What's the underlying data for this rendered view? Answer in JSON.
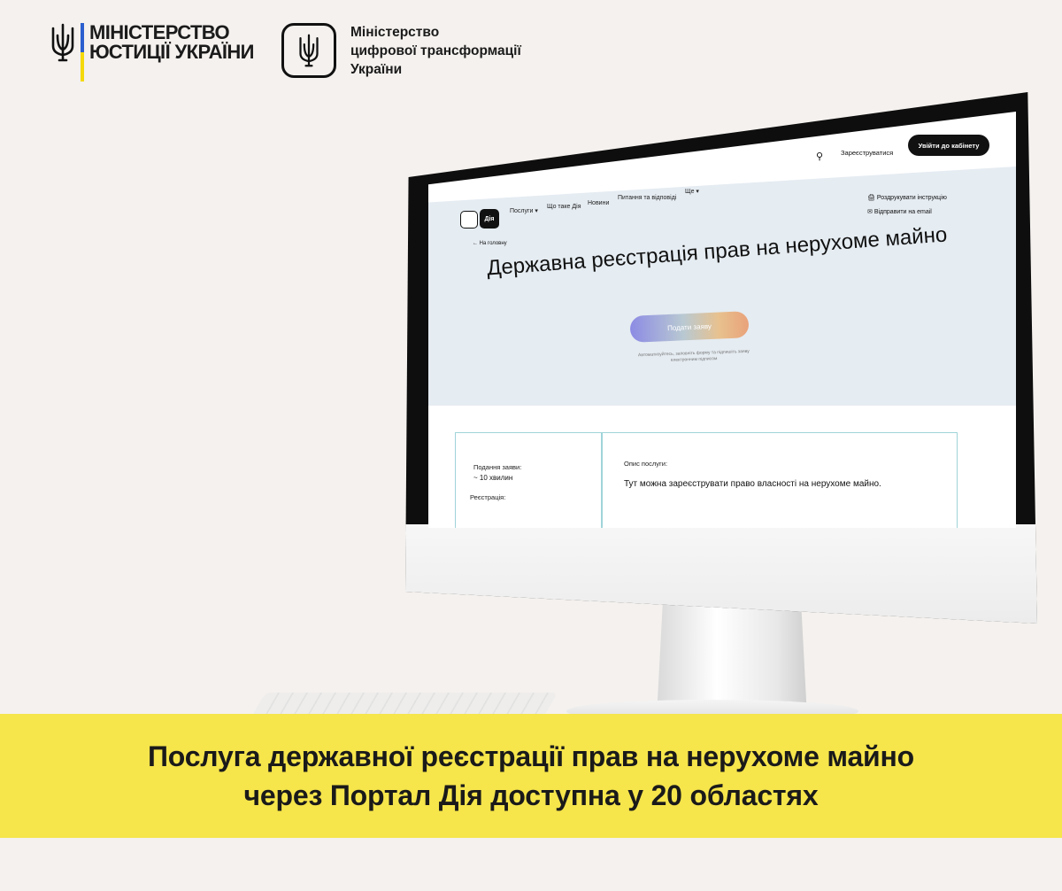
{
  "logos": {
    "moj": {
      "line1": "МІНІСТЕРСТВО",
      "line2": "ЮСТИЦІЇ УКРАЇНИ"
    },
    "mdt": {
      "line1": "Міністерство",
      "line2": "цифрової трансформації",
      "line3": "України"
    }
  },
  "portal": {
    "nav": {
      "logo_label": "Дія",
      "items": [
        "Послуги ▾",
        "Що таке Дія",
        "Новини",
        "Питання та відповіді",
        "Ще ▾"
      ],
      "register": "Зареєструватися",
      "login": "Увійти до кабінету",
      "search_icon": "search-icon"
    },
    "side_links": [
      "Роздрукувати інструкцію",
      "Відправити на email"
    ],
    "back": "На головну",
    "title": "Державна реєстрація прав на нерухоме майно",
    "apply_button": "Подати заяву",
    "apply_hint": "Автоматизуйтесь, заповніть форму та підпишіть заяву електронним підписом",
    "card": {
      "submit_label": "Подання заяви:",
      "submit_value": "~ 10 хвилин",
      "registration_label": "Реєстрація:",
      "desc_label": "Опис послуги:",
      "desc_text": "Тут можна зареєструвати право власності на нерухоме майно."
    }
  },
  "banner": {
    "line1": "Послуга державної реєстрації прав на нерухоме майно",
    "line2": "через Портал Дія доступна у 20 областях"
  },
  "colors": {
    "banner": "#f6e54b",
    "background": "#f4f1ee",
    "flag_blue": "#2b5fcf",
    "flag_yellow": "#f5d90a"
  }
}
